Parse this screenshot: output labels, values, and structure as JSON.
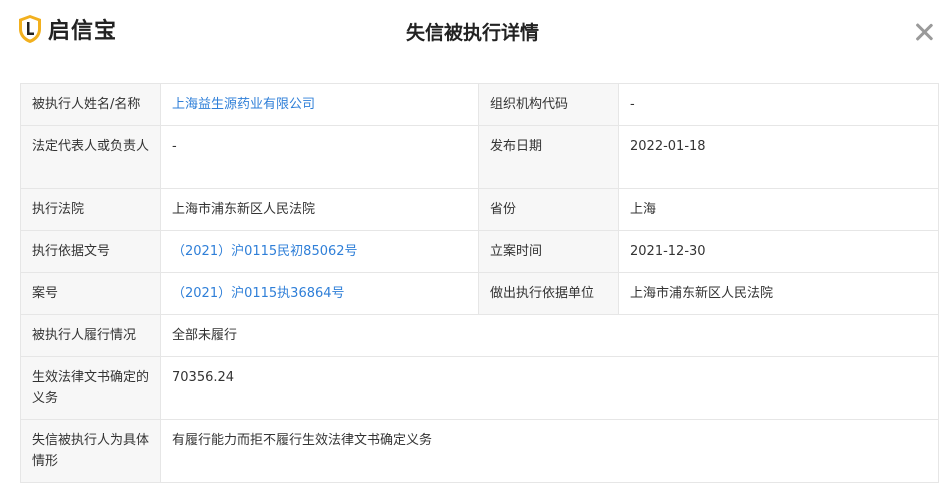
{
  "header": {
    "logo_text": "启信宝",
    "title": "失信被执行详情"
  },
  "colors": {
    "link": "#2f7fd8",
    "logo_gold": "#f2b01e",
    "label_bg": "#f7f7f7"
  },
  "icons": {
    "logo": "shield-logo-icon",
    "close": "close-icon"
  },
  "fields": {
    "name_label": "被执行人姓名/名称",
    "name_value": "上海益生源药业有限公司",
    "org_code_label": "组织机构代码",
    "org_code_value": "-",
    "legal_rep_label": "法定代表人或负责人",
    "legal_rep_value": "-",
    "publish_date_label": "发布日期",
    "publish_date_value": "2022-01-18",
    "court_label": "执行法院",
    "court_value": "上海市浦东新区人民法院",
    "province_label": "省份",
    "province_value": "上海",
    "basis_doc_label": "执行依据文号",
    "basis_doc_value": "（2021）沪0115民初85062号",
    "filing_time_label": "立案时间",
    "filing_time_value": "2021-12-30",
    "case_no_label": "案号",
    "case_no_value": "（2021）沪0115执36864号",
    "basis_unit_label": "做出执行依据单位",
    "basis_unit_value": "上海市浦东新区人民法院",
    "performance_label": "被执行人履行情况",
    "performance_value": "全部未履行",
    "obligation_label": "生效法律文书确定的义务",
    "obligation_value": "70356.24",
    "circumstance_label": "失信被执行人为具体情形",
    "circumstance_value": "有履行能力而拒不履行生效法律文书确定义务"
  }
}
